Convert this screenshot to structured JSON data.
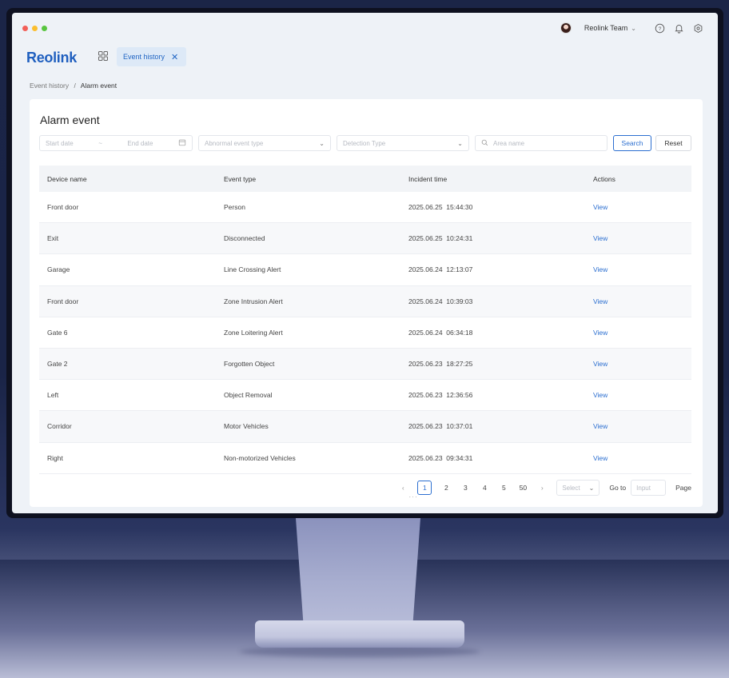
{
  "colors": {
    "accent": "#2c6fd0",
    "brand": "#1f5fbf",
    "dot_red": "#f25f58",
    "dot_yellow": "#fbbe2e",
    "dot_green": "#58c53f"
  },
  "topbar": {
    "user_name": "Reolink Team",
    "icons": [
      "help-icon",
      "bell-icon",
      "settings-icon"
    ]
  },
  "brand": {
    "logo": "Reolink"
  },
  "tabs": [
    {
      "label": "Event history"
    }
  ],
  "breadcrumb": {
    "parent": "Event history",
    "separator": "/",
    "current": "Alarm event"
  },
  "page": {
    "title": "Alarm event"
  },
  "filters": {
    "start_date_placeholder": "Start date",
    "range_separator": "~",
    "end_date_placeholder": "End date",
    "event_type_placeholder": "Abnormal event type",
    "detection_type_placeholder": "Detection Type",
    "area_placeholder": "Area name",
    "search_label": "Search",
    "reset_label": "Reset"
  },
  "table": {
    "columns": [
      "Device name",
      "Event type",
      "Incident time",
      "Actions"
    ],
    "rows": [
      {
        "device": "Front door",
        "event": "Person",
        "time": "2025.06.25  15:44:30",
        "action": "View"
      },
      {
        "device": "Exit",
        "event": "Disconnected",
        "time": "2025.06.25  10:24:31",
        "action": "View"
      },
      {
        "device": "Garage",
        "event": "Line Crossing Alert",
        "time": "2025.06.24  12:13:07",
        "action": "View"
      },
      {
        "device": "Front door",
        "event": "Zone Intrusion Alert",
        "time": "2025.06.24  10:39:03",
        "action": "View"
      },
      {
        "device": "Gate 6",
        "event": "Zone Loitering Alert",
        "time": "2025.06.24  06:34:18",
        "action": "View"
      },
      {
        "device": "Gate 2",
        "event": "Forgotten Object",
        "time": "2025.06.23  18:27:25",
        "action": "View"
      },
      {
        "device": "Left",
        "event": "Object Removal",
        "time": "2025.06.23  12:36:56",
        "action": "View"
      },
      {
        "device": "Corridor",
        "event": "Motor Vehicles",
        "time": "2025.06.23  10:37:01",
        "action": "View"
      },
      {
        "device": "Right",
        "event": "Non-motorized Vehicles",
        "time": "2025.06.23  09:34:31",
        "action": "View"
      }
    ]
  },
  "pagination": {
    "prev": "‹",
    "pages": [
      "1",
      "2",
      "3",
      "4",
      "5"
    ],
    "ellipsis": "···",
    "last": "50",
    "next": "›",
    "current": "1",
    "select_placeholder": "Select",
    "goto_label": "Go to",
    "input_placeholder": "Input",
    "page_label": "Page"
  }
}
